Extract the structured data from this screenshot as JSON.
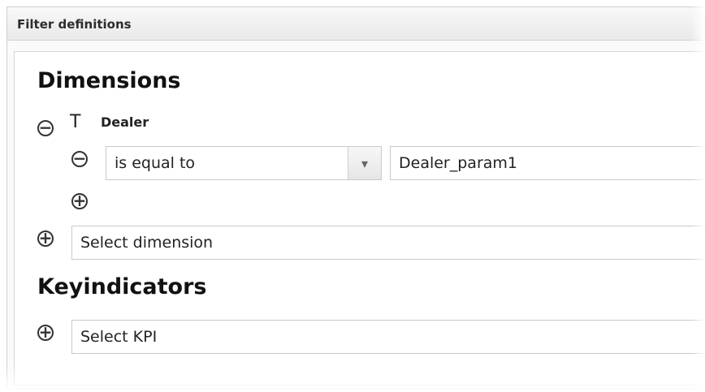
{
  "panel": {
    "title": "Filter definitions"
  },
  "dimensions": {
    "title": "Dimensions",
    "field": {
      "label": "Dealer",
      "type_icon": "T"
    },
    "condition": {
      "operator": "is equal to",
      "value": "Dealer_param1"
    },
    "select_dimension": "Select dimension"
  },
  "keyindicators": {
    "title": "Keyindicators",
    "select_kpi": "Select KPI"
  },
  "icons": {
    "minus": "−",
    "plus": "+",
    "dropdown_arrow": "▾"
  }
}
